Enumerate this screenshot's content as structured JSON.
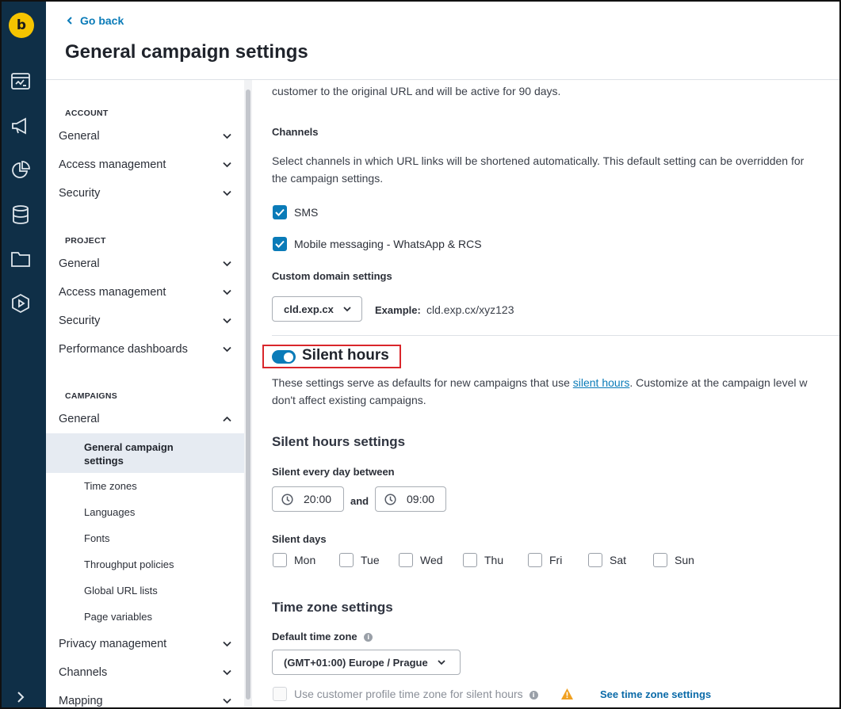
{
  "header": {
    "back_label": "Go back",
    "title": "General campaign settings"
  },
  "rail": {
    "logo": "b",
    "icons": [
      "dashboard-icon",
      "megaphone-icon",
      "pie-chart-icon",
      "database-icon",
      "folder-icon",
      "play-icon",
      "expand-icon"
    ]
  },
  "sidebar": {
    "account": {
      "label": "ACCOUNT",
      "items": [
        "General",
        "Access management",
        "Security"
      ]
    },
    "project": {
      "label": "PROJECT",
      "items": [
        "General",
        "Access management",
        "Security",
        "Performance dashboards"
      ]
    },
    "campaigns": {
      "label": "CAMPAIGNS",
      "general": "General",
      "active_sub": "General campaign\nsettings",
      "subs": [
        "Time zones",
        "Languages",
        "Fonts",
        "Throughput policies",
        "Global URL lists",
        "Page variables"
      ],
      "after": [
        "Privacy management",
        "Channels",
        "Mapping"
      ]
    }
  },
  "content": {
    "top_text": "customer to the original URL and will be active for 90 days.",
    "channels": {
      "title": "Channels",
      "desc_1": "Select channels in which URL links will be shortened automatically. This default setting can be overridden for",
      "desc_2": "the campaign settings.",
      "options": [
        {
          "label": "SMS",
          "checked": true
        },
        {
          "label": "Mobile messaging - WhatsApp & RCS",
          "checked": true
        }
      ]
    },
    "custom_domain": {
      "title": "Custom domain settings",
      "selected": "cld.exp.cx",
      "example_label": "Example:",
      "example_value": "cld.exp.cx/xyz123"
    },
    "silent_hours": {
      "title": "Silent hours",
      "enabled": true,
      "desc_before": "These settings serve as defaults for new campaigns that use ",
      "desc_link": "silent hours",
      "desc_after": ". Customize at the campaign level w",
      "desc_line2": "don't affect existing campaigns.",
      "settings_title": "Silent hours settings",
      "every_day_label": "Silent every day between",
      "from": "20:00",
      "and": "and",
      "to": "09:00",
      "days_label": "Silent days",
      "days": [
        "Mon",
        "Tue",
        "Wed",
        "Thu",
        "Fri",
        "Sat",
        "Sun"
      ]
    },
    "time_zone": {
      "title": "Time zone settings",
      "default_label": "Default time zone",
      "selected": "(GMT+01:00) Europe / Prague",
      "profile_option": "Use customer profile time zone for silent hours",
      "see_link": "See time zone settings"
    }
  },
  "colors": {
    "rail": "#0f2f47",
    "accent": "#0a7bb8",
    "logo": "#f5c400",
    "highlight": "#d9262b",
    "warning": "#f0a020"
  }
}
